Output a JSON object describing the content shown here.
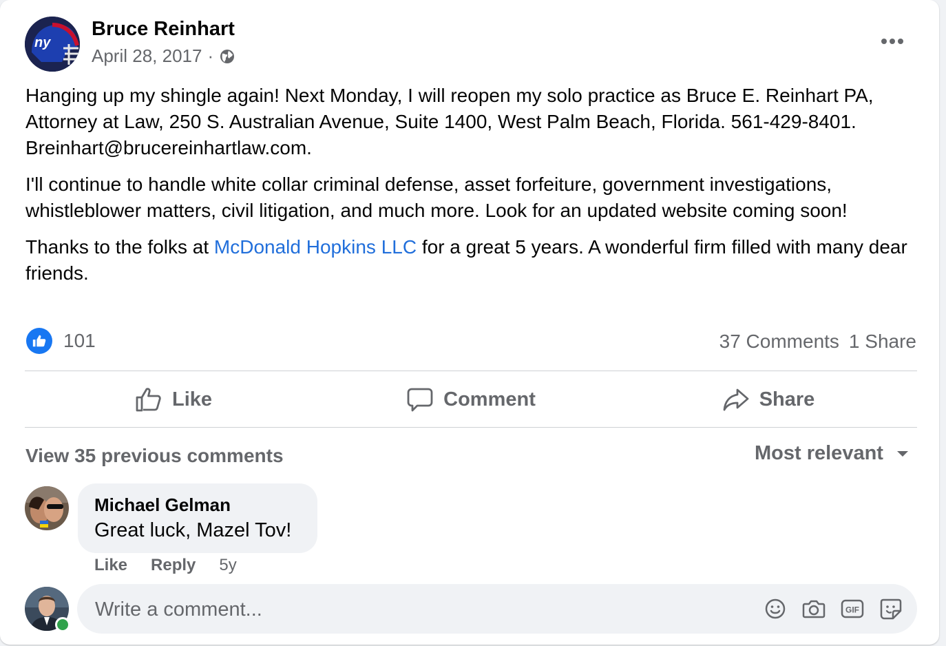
{
  "post": {
    "author_name": "Bruce Reinhart",
    "date": "April 28, 2017",
    "separator": "·",
    "audience_icon": "globe-icon",
    "paragraph1": "Hanging up my shingle again!  Next Monday, I will reopen my solo practice as Bruce E. Reinhart PA, Attorney at Law, 250 S. Australian Avenue, Suite 1400, West Palm Beach, Florida.  561-429-8401.  Breinhart@brucereinhartlaw.com.",
    "paragraph2": "I'll continue to handle white collar criminal defense, asset forfeiture, government investigations, whistleblower matters, civil litigation, and much more.  Look for an updated website coming soon!",
    "paragraph3_before": "Thanks to the folks at ",
    "paragraph3_link": "McDonald Hopkins LLC",
    "paragraph3_after": " for a great 5 years.  A wonderful firm filled with many dear friends."
  },
  "stats": {
    "reaction_count": "101",
    "comments": "37 Comments",
    "shares": "1 Share"
  },
  "actions": {
    "like": "Like",
    "comment": "Comment",
    "share": "Share"
  },
  "comments_section": {
    "view_previous": "View 35 previous comments",
    "sort": "Most relevant",
    "items": [
      {
        "name": "Michael Gelman",
        "text": "Great luck, Mazel Tov!",
        "like": "Like",
        "reply": "Reply",
        "time": "5y"
      }
    ]
  },
  "composer": {
    "placeholder": "Write a comment..."
  },
  "colors": {
    "link": "#216fdb",
    "like_blue": "#1877f2",
    "secondary_text": "#65676b",
    "online": "#31a24c"
  }
}
